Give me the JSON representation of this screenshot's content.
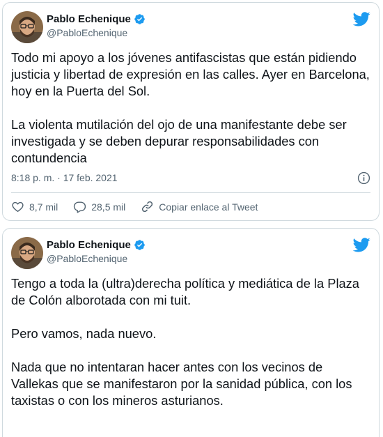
{
  "tweets": [
    {
      "author_name": "Pablo Echenique",
      "handle": "@PabloEchenique",
      "text": "Todo mi apoyo a los jóvenes antifascistas que están pidiendo justicia y libertad de expresión en las calles. Ayer en Barcelona, hoy en la Puerta del Sol.\n\nLa violenta mutilación del ojo de una manifestante debe ser investigada y se deben depurar responsabilidades con contundencia",
      "timestamp": "8:18 p. m. · 17 feb. 2021",
      "likes": "8,7 mil",
      "replies": "28,5 mil",
      "copy_link_label": "Copiar enlace al Tweet"
    },
    {
      "author_name": "Pablo Echenique",
      "handle": "@PabloEchenique",
      "text": "Tengo a toda la (ultra)derecha política y mediática de la Plaza de Colón alborotada con mi tuit.\n\nPero vamos, nada nuevo.\n\nNada que no intentaran hacer antes con los vecinos de Vallekas que se manifestaron por la sanidad pública, con los taxistas o con los mineros asturianos."
    }
  ],
  "colors": {
    "twitter_blue": "#1d9bf0",
    "text_primary": "#0f1419",
    "text_secondary": "#536471",
    "border": "#cfd9de"
  },
  "icons": {
    "verified": "verified-badge-icon",
    "logo": "twitter-bird-icon",
    "info": "info-icon",
    "like": "heart-icon",
    "reply": "reply-bubble-icon",
    "copy_link": "link-icon"
  }
}
